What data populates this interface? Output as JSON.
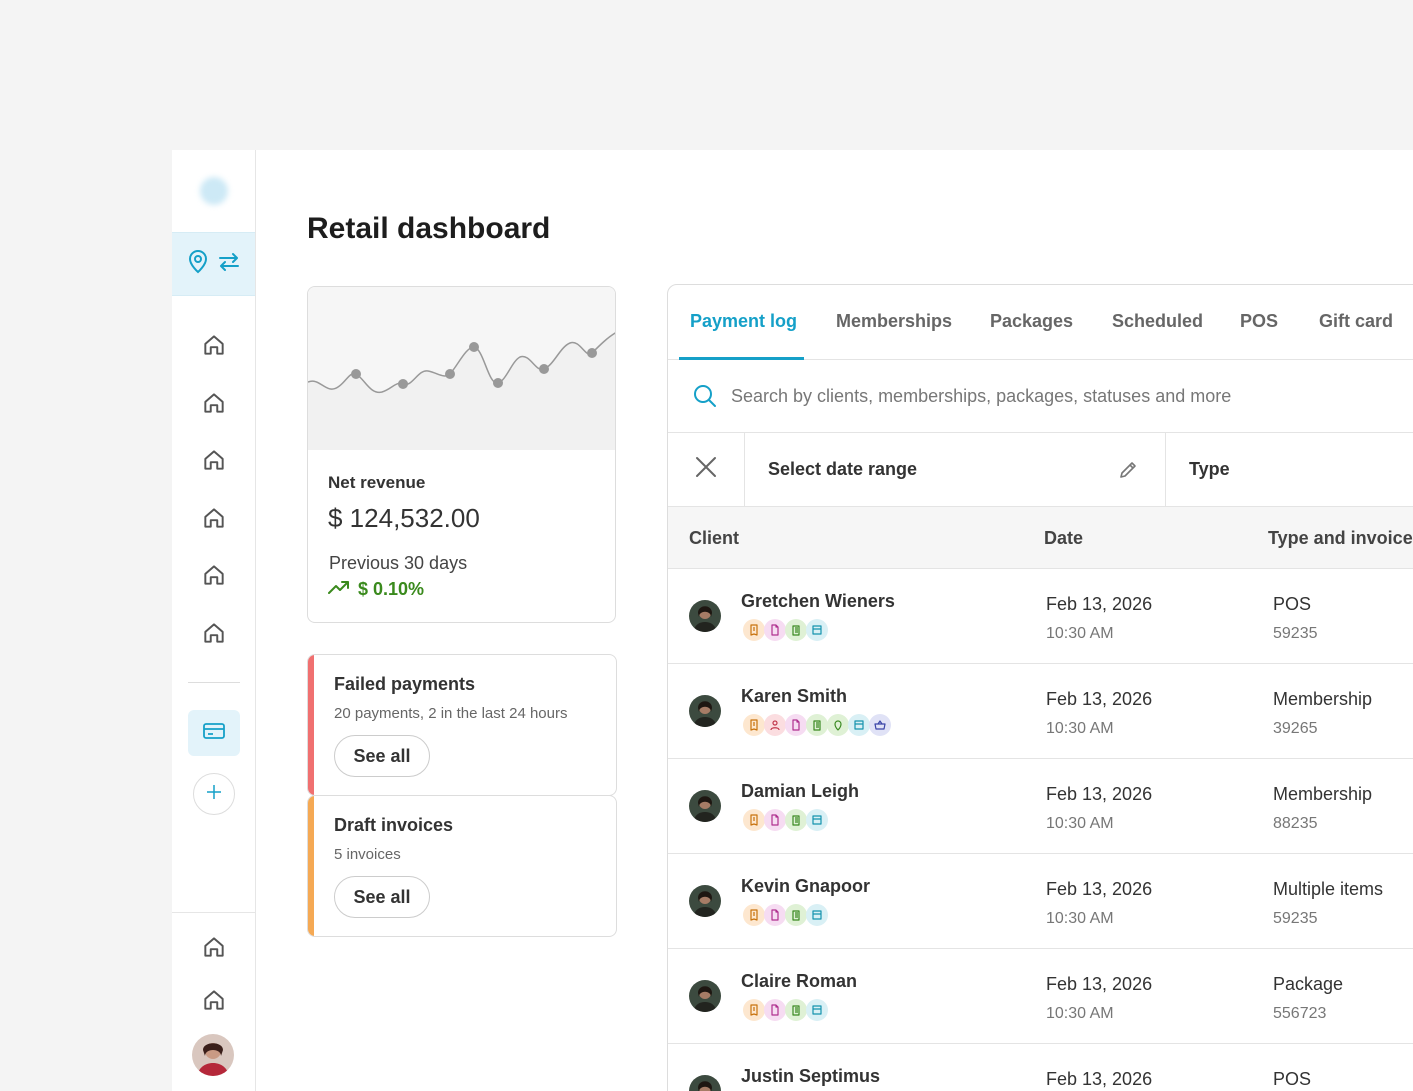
{
  "page": {
    "title": "Retail dashboard"
  },
  "revenue": {
    "label": "Net revenue",
    "value": "$ 124,532.00",
    "period": "Previous 30 days",
    "change": "$ 0.10%"
  },
  "alerts": [
    {
      "title": "Failed payments",
      "subtitle": "20 payments, 2 in the last 24 hours",
      "button": "See all",
      "color": "#f07070"
    },
    {
      "title": "Draft invoices",
      "subtitle": "5 invoices",
      "button": "See all",
      "color": "#f5a954"
    }
  ],
  "tabs": [
    "Payment log",
    "Memberships",
    "Packages",
    "Scheduled",
    "POS",
    "Gift card"
  ],
  "search": {
    "placeholder": "Search by clients, memberships, packages, statuses and more"
  },
  "filters": {
    "date_label": "Select date range",
    "type_label": "Type"
  },
  "table": {
    "headers": {
      "client": "Client",
      "date": "Date",
      "type": "Type and invoice"
    },
    "rows": [
      {
        "name": "Gretchen Wieners",
        "date": "Feb 13, 2026",
        "time": "10:30 AM",
        "type": "POS",
        "invoice": "59235",
        "icons": [
          "receipt",
          "document",
          "list",
          "card"
        ]
      },
      {
        "name": "Karen Smith",
        "date": "Feb 13, 2026",
        "time": "10:30 AM",
        "type": "Membership",
        "invoice": "39265",
        "icons": [
          "receipt",
          "person",
          "document",
          "list",
          "location",
          "card",
          "basket"
        ]
      },
      {
        "name": "Damian Leigh",
        "date": "Feb 13, 2026",
        "time": "10:30 AM",
        "type": "Membership",
        "invoice": "88235",
        "icons": [
          "receipt",
          "document",
          "list",
          "card"
        ]
      },
      {
        "name": "Kevin Gnapoor",
        "date": "Feb 13, 2026",
        "time": "10:30 AM",
        "type": "Multiple items",
        "invoice": "59235",
        "icons": [
          "receipt",
          "document",
          "list",
          "card"
        ]
      },
      {
        "name": "Claire Roman",
        "date": "Feb 13, 2026",
        "time": "10:30 AM",
        "type": "Package",
        "invoice": "556723",
        "icons": [
          "receipt",
          "document",
          "list",
          "card"
        ]
      },
      {
        "name": "Justin Septimus",
        "date": "Feb 13, 2026",
        "time": "",
        "type": "POS",
        "invoice": "",
        "icons": []
      }
    ]
  },
  "colors": {
    "accent": "#15a0c8",
    "positive": "#3a8a1d",
    "failed": "#f07070",
    "draft": "#f5a954"
  }
}
